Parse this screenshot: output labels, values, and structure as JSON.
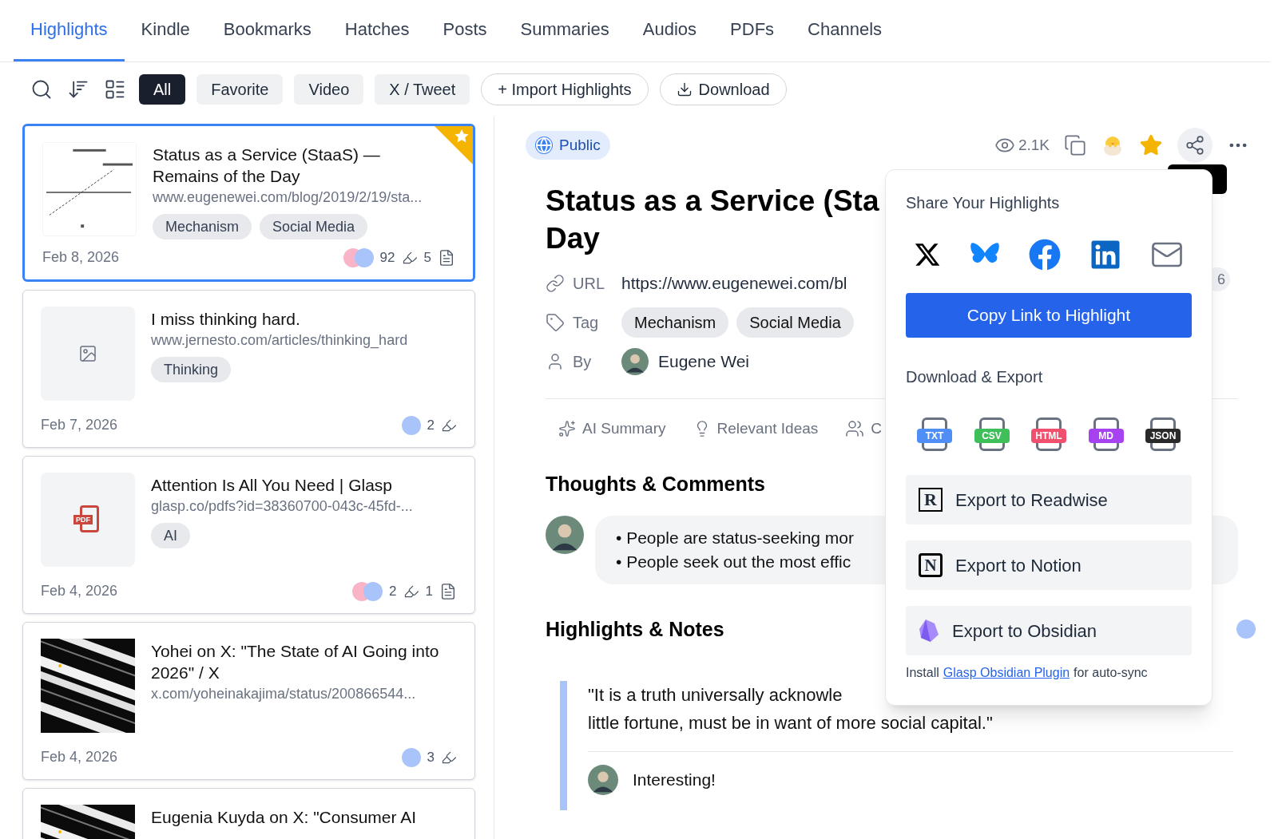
{
  "tabs": [
    {
      "label": "Highlights",
      "selected": true
    },
    {
      "label": "Kindle",
      "selected": false
    },
    {
      "label": "Bookmarks",
      "selected": false
    },
    {
      "label": "Hatches",
      "selected": false
    },
    {
      "label": "Posts",
      "selected": false
    },
    {
      "label": "Summaries",
      "selected": false
    },
    {
      "label": "Audios",
      "selected": false
    },
    {
      "label": "PDFs",
      "selected": false
    },
    {
      "label": "Channels",
      "selected": false
    }
  ],
  "toolbar": {
    "filters": [
      {
        "label": "All",
        "selected": true
      },
      {
        "label": "Favorite",
        "selected": false
      },
      {
        "label": "Video",
        "selected": false
      },
      {
        "label": "X / Tweet",
        "selected": false
      }
    ],
    "import_button": "+ Import Highlights",
    "download_button": "Download"
  },
  "cards": [
    {
      "selected": true,
      "favorite": true,
      "thumbnail": {
        "kind": "chart"
      },
      "title": "Status as a Service (StaaS) — Remains of the Day",
      "url": "www.eugenewei.com/blog/2019/2/19/sta...",
      "tags": [
        "Mechanism",
        "Social Media"
      ],
      "date": "Feb 8, 2026",
      "readers": [
        {
          "color": "#f9b4c8"
        },
        {
          "color": "#a9c4fb"
        }
      ],
      "highlight_count": "92",
      "note_count": "5"
    },
    {
      "selected": false,
      "favorite": false,
      "thumbnail": {
        "kind": "placeholder"
      },
      "title": "I miss thinking hard.",
      "url": "www.jernesto.com/articles/thinking_hard",
      "tags": [
        "Thinking"
      ],
      "date": "Feb 7, 2026",
      "readers": [
        {
          "color": "#a9c4fb"
        }
      ],
      "highlight_count": "2"
    },
    {
      "selected": false,
      "favorite": false,
      "thumbnail": {
        "kind": "pdf",
        "label": "PDF"
      },
      "title": "Attention Is All You Need | Glasp",
      "url": "glasp.co/pdfs?id=38360700-043c-45fd-...",
      "tags": [
        "AI"
      ],
      "date": "Feb 4, 2026",
      "readers": [
        {
          "color": "#f9b4c8"
        },
        {
          "color": "#a9c4fb"
        }
      ],
      "highlight_count": "2",
      "note_count": "1"
    },
    {
      "selected": false,
      "favorite": false,
      "thumbnail": {
        "kind": "picture"
      },
      "title": "Yohei on X: \"The State of AI Going into 2026\" / X",
      "url": "x.com/yoheinakajima/status/200866544...",
      "date": "Feb 4, 2026",
      "readers": [
        {
          "color": "#a9c4fb"
        }
      ],
      "highlight_count": "3"
    },
    {
      "selected": false,
      "favorite": false,
      "thumbnail": {
        "kind": "picture"
      },
      "title": "Eugenia Kuyda on X: \"Consumer AI"
    }
  ],
  "detail": {
    "visibility": "Public",
    "views": "2.1K",
    "favorite": true,
    "title_lines": [
      "Status as a Service (Sta",
      "Day"
    ],
    "meta": [
      {
        "kind": "url",
        "label": "URL",
        "value": "https://www.eugenewei.com/bl",
        "badge": "6"
      },
      {
        "kind": "tags",
        "label": "Tag",
        "tags": [
          "Mechanism",
          "Social Media"
        ]
      },
      {
        "kind": "author",
        "label": "By",
        "value": "Eugene Wei"
      }
    ],
    "section_tabs": [
      {
        "kind": "summary",
        "label": "AI Summary"
      },
      {
        "kind": "ideas",
        "label": "Relevant Ideas"
      },
      {
        "kind": "people",
        "label": "C"
      }
    ],
    "thoughts": {
      "heading": "Thoughts & Comments",
      "lines": [
        "• People are status-seeking mor",
        "• People seek out the most effic"
      ]
    },
    "highlights": {
      "heading": "Highlights & Notes",
      "quote_lines": [
        "\"It is a truth universally acknowle",
        "little fortune, must be in want of more social capital.\""
      ],
      "note": "Interesting!"
    }
  },
  "share_popup": {
    "share_title": "Share Your Highlights",
    "targets": [
      {
        "kind": "x"
      },
      {
        "kind": "bluesky"
      },
      {
        "kind": "facebook"
      },
      {
        "kind": "linkedin"
      },
      {
        "kind": "email"
      }
    ],
    "copy_button": "Copy Link to Highlight",
    "export_title": "Download & Export",
    "formats": [
      {
        "label": "TXT",
        "color": "#4f8ef7"
      },
      {
        "label": "CSV",
        "color": "#3fbf5a"
      },
      {
        "label": "HTML",
        "color": "#f0506e"
      },
      {
        "label": "MD",
        "color": "#a742f0"
      },
      {
        "label": "JSON",
        "color": "#2a2a2a"
      }
    ],
    "integrations": [
      {
        "kind": "readwise",
        "icon_text": "R",
        "label": "Export to Readwise"
      },
      {
        "kind": "notion",
        "icon_text": "N",
        "label": "Export to Notion"
      },
      {
        "kind": "obsidian",
        "label": "Export to Obsidian"
      }
    ],
    "footer": {
      "before": "Install",
      "link": "Glasp Obsidian Plugin",
      "after": "for auto-sync"
    }
  }
}
